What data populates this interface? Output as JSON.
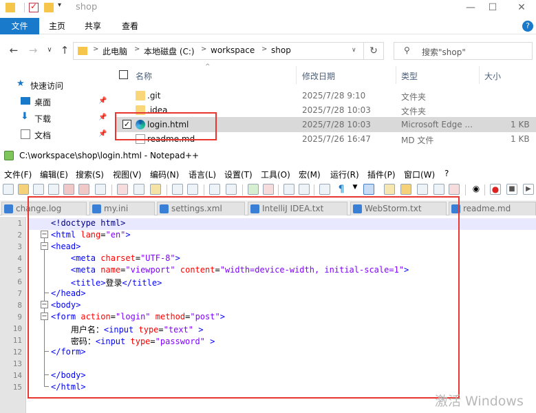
{
  "explorer": {
    "title": "shop",
    "window_buttons": [
      "—",
      "☐",
      "✕"
    ],
    "ribbon_tabs": [
      "文件",
      "主页",
      "共享",
      "查看"
    ],
    "help_glyph": "?",
    "nav_glyphs": [
      "←",
      "→",
      "∨",
      "↑"
    ],
    "breadcrumb": [
      "此电脑",
      "本地磁盘 (C:)",
      "workspace",
      "shop"
    ],
    "crumb_separator": ">",
    "refresh_glyph": "↻",
    "search_placeholder": "搜索\"shop\"",
    "sidebar": [
      {
        "label": "快速访问",
        "icon": "star-icon"
      },
      {
        "label": "桌面",
        "icon": "desktop-icon"
      },
      {
        "label": "下载",
        "icon": "download-icon"
      },
      {
        "label": "文档",
        "icon": "document-icon"
      }
    ],
    "columns": [
      "名称",
      "修改日期",
      "类型",
      "大小"
    ],
    "files": [
      {
        "name": ".git",
        "date": "2025/7/28 9:10",
        "type": "文件夹",
        "size": "",
        "icon": "folder-icon"
      },
      {
        "name": ".idea",
        "date": "2025/7/28 10:03",
        "type": "文件夹",
        "size": "",
        "icon": "folder-icon"
      },
      {
        "name": "login.html",
        "date": "2025/7/28 10:03",
        "type": "Microsoft Edge ...",
        "size": "1 KB",
        "icon": "edge-icon",
        "selected": true
      },
      {
        "name": "readme.md",
        "date": "2025/7/26 16:47",
        "type": "MD 文件",
        "size": "1 KB",
        "icon": "file-icon"
      }
    ]
  },
  "notepad": {
    "title": "C:\\workspace\\shop\\login.html - Notepad++",
    "menus": [
      "文件(F)",
      "编辑(E)",
      "搜索(S)",
      "视图(V)",
      "编码(N)",
      "语言(L)",
      "设置(T)",
      "工具(O)",
      "宏(M)",
      "运行(R)",
      "插件(P)",
      "窗口(W)",
      "?"
    ],
    "tabs": [
      "change.log",
      "my.ini",
      "settings.xml",
      "IntelliJ IDEA.txt",
      "WebStorm.txt",
      "readme.md"
    ],
    "code_lines": [
      "<!doctype html>",
      "<html lang=\"en\">",
      "<head>",
      "    <meta charset=\"UTF-8\">",
      "    <meta name=\"viewport\" content=\"width=device-width, initial-scale=1\">",
      "    <title>登录</title>",
      "</head>",
      "<body>",
      "<form action=\"login\" method=\"post\">",
      "    用户名：<input type=\"text\" >",
      "    密码：<input type=\"password\" >",
      "</form>",
      "",
      "</body>",
      "</html>"
    ],
    "current_line": 1
  },
  "watermark": "激活 Windows",
  "colors": {
    "highlight": "#e8362f",
    "accent": "#1979ca"
  }
}
